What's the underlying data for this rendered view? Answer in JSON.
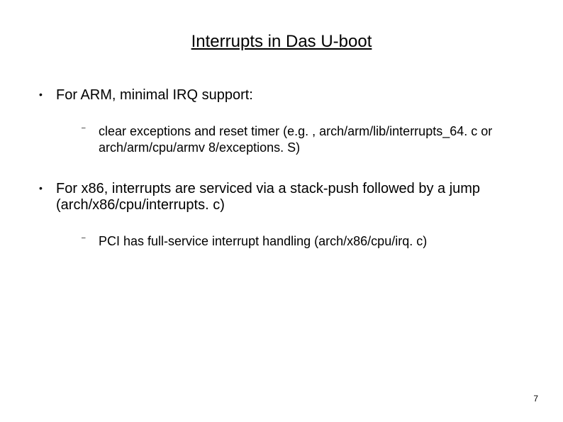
{
  "title": "Interrupts in Das U-boot",
  "bullets": [
    {
      "text": "For ARM, minimal IRQ support:",
      "subitems": [
        "clear exceptions and reset timer (e.g. , arch/arm/lib/interrupts_64. c or arch/arm/cpu/armv 8/exceptions. S)"
      ]
    },
    {
      "text": "For x86, interrupts are serviced via a stack-push followed by a jump (arch/x86/cpu/interrupts. c)",
      "subitems": [
        "PCI has full-service interrupt handling (arch/x86/cpu/irq. c)"
      ]
    }
  ],
  "pageNumber": "7"
}
